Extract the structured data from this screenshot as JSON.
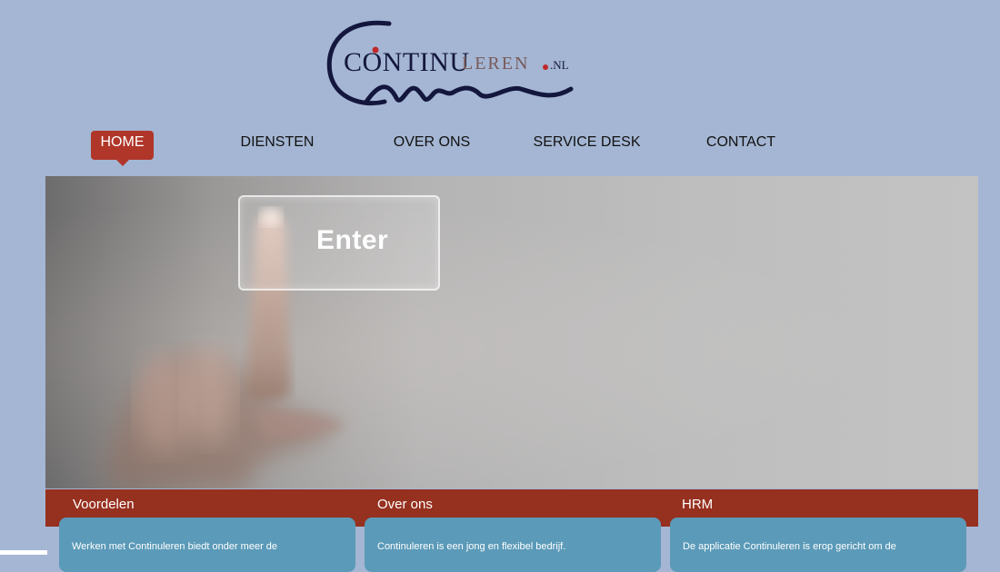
{
  "logo": {
    "main": "CONTINU",
    "sub": "LEREN",
    "tld": ".NL",
    "colors": {
      "navy": "#14173d",
      "red": "#c0282a"
    }
  },
  "nav": {
    "items": [
      {
        "label": "HOME",
        "active": true
      },
      {
        "label": "DIENSTEN"
      },
      {
        "label": "OVER ONS"
      },
      {
        "label": "SERVICE DESK"
      },
      {
        "label": "CONTACT"
      }
    ]
  },
  "hero": {
    "key_label": "Enter"
  },
  "sections": [
    {
      "title": "Voordelen",
      "text": "Werken met Continuleren biedt onder meer de"
    },
    {
      "title": "Over ons",
      "text": "Continuleren is een jong en flexibel bedrijf."
    },
    {
      "title": "HRM",
      "text": "De applicatie Continuleren is erop gericht om de"
    }
  ],
  "colors": {
    "background": "#a4b6d3",
    "accent": "#b0362a",
    "band": "#96301f",
    "panel": "#5b9ab8"
  }
}
